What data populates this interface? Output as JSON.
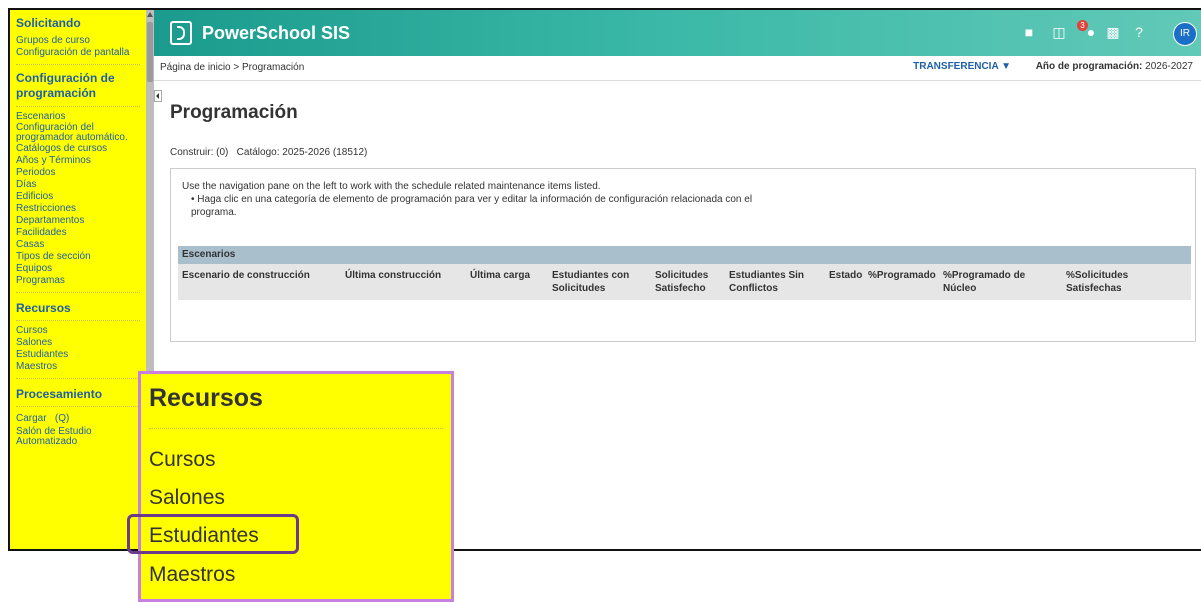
{
  "sidebar": {
    "sections": [
      {
        "title": "Solicitando",
        "items": [
          "Grupos de curso",
          "Configuración de pantalla"
        ]
      },
      {
        "title": "Configuración de programación",
        "items": [
          "Escenarios",
          "Configuración del programador automático.",
          "Catálogos de cursos",
          "Años y Términos",
          "Periodos",
          "Días",
          "Edificios",
          "Restricciones",
          "Departamentos",
          "Facilidades",
          "Casas",
          "Tipos de sección",
          "Equipos",
          "Programas"
        ]
      },
      {
        "title": "Recursos",
        "items": [
          "Cursos",
          "Salones",
          "Estudiantes",
          "Maestros"
        ]
      },
      {
        "title": "Procesamiento",
        "items": [
          "Cargar   (Q)",
          "Salón de Estudio Automatizado"
        ]
      }
    ]
  },
  "header": {
    "brand": "PowerSchool SIS",
    "notification_count": "3",
    "avatar_initials": "IR",
    "icons": [
      "notes-icon",
      "translate-icon",
      "alerts-icon",
      "print-icon",
      "help-icon"
    ]
  },
  "breadcrumb": "Página de inicio > Programación",
  "transfer_label": "TRANSFERENCIA",
  "year_label": "Año de programación:",
  "year_value": "2026-2027",
  "main": {
    "title": "Programación",
    "build_line": "Construir: (0)   Catálogo: 2025-2026 (18512)",
    "info_text": "Use the navigation pane on the left to work with the schedule related maintenance items listed.",
    "bullet_text": "Haga clic en una categoría de elemento de programación para ver y editar la información de configuración relacionada con el programa.",
    "table_title": "Escenarios",
    "columns": [
      "Escenario de construcción",
      "Última construcción",
      "Última carga",
      "Estudiantes con Solicitudes",
      "Solicitudes Satisfecho",
      "Estudiantes Sin Conflictos",
      "Estado",
      "%Programado",
      "%Programado de Núcleo",
      "%Solicitudes Satisfechas"
    ]
  },
  "zoom": {
    "title": "Recursos",
    "items": [
      "Cursos",
      "Salones",
      "Estudiantes",
      "Maestros"
    ],
    "highlighted": "Estudiantes"
  },
  "colors": {
    "sidebar": "#ffff00",
    "header_start": "#1a9b8d",
    "link": "#1f5fa8",
    "callout_border": "#c77fe0",
    "highlight_border": "#6b3a8a"
  }
}
